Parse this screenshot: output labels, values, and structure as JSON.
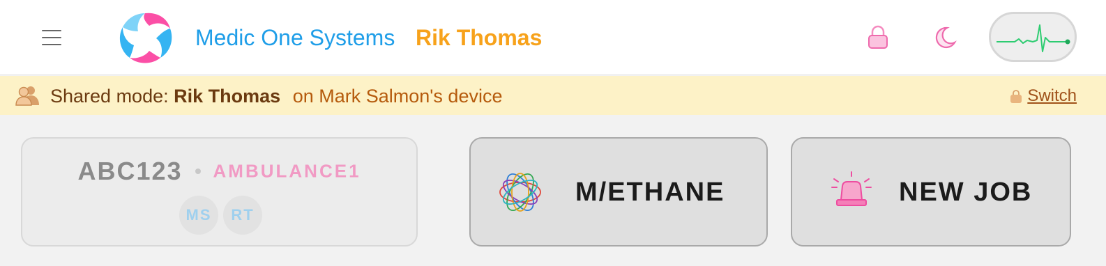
{
  "header": {
    "app_name": "Medic One Systems",
    "user_name": "Rik Thomas",
    "icons": {
      "menu": "hamburger-menu-icon",
      "logo": "swirl-logo",
      "lock": "lock-icon",
      "theme": "moon-icon",
      "status": "heartbeat-pulse-icon"
    }
  },
  "share_bar": {
    "label": "Shared mode:",
    "shared_user": "Rik Thomas",
    "device_text": "on Mark Salmon's device",
    "switch_label": "Switch",
    "icons": {
      "people": "people-icon",
      "lock": "lock-icon"
    }
  },
  "vehicle": {
    "callsign": "ABC123",
    "name": "AMBULANCE1",
    "crew": [
      "MS",
      "RT"
    ]
  },
  "actions": {
    "methane_label": "M/ETHANE",
    "new_job_label": "NEW JOB",
    "icons": {
      "methane": "atom-rings-icon",
      "new_job": "siren-light-icon"
    }
  },
  "colors": {
    "app_name": "#1f9ee8",
    "user_name": "#f7a21b",
    "accent_pink": "#ee4da0",
    "share_bar_bg": "#fdf2c7",
    "pulse_green": "#2ecc71"
  }
}
